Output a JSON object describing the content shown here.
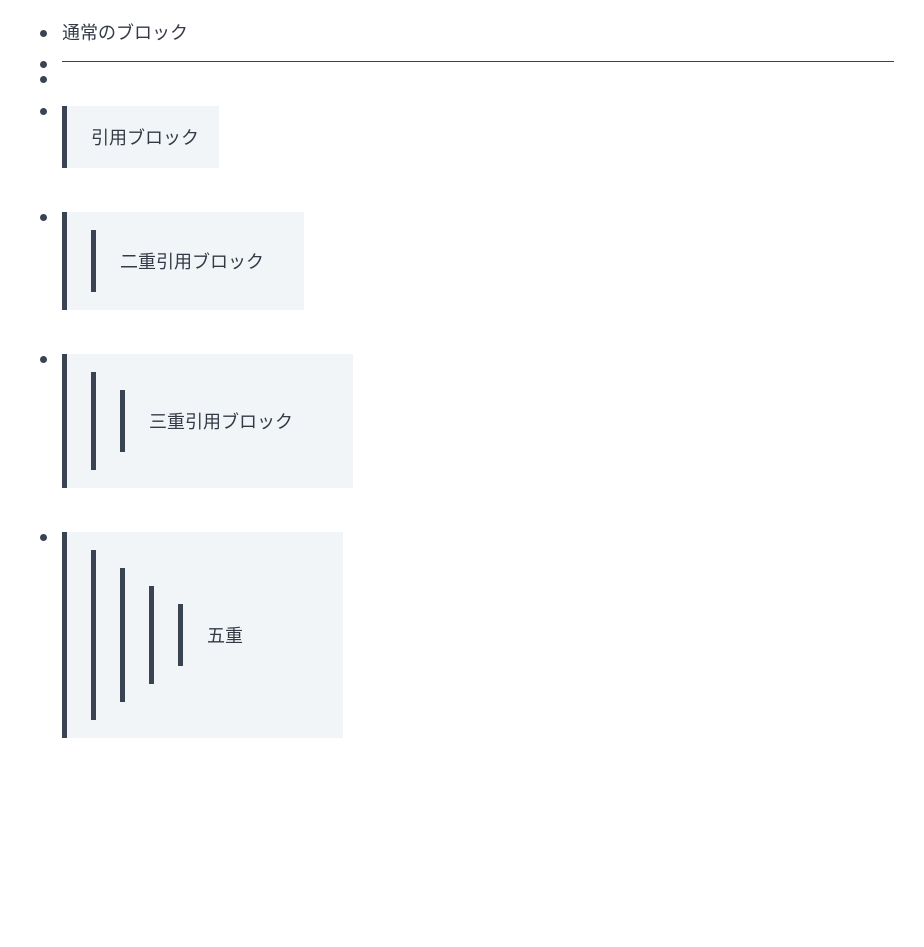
{
  "list": {
    "items": [
      {
        "type": "text",
        "text": "通常のブロック"
      },
      {
        "type": "hr"
      },
      {
        "type": "empty"
      },
      {
        "type": "blockquote",
        "depth": 1,
        "text": "引用ブロック"
      },
      {
        "type": "blockquote",
        "depth": 2,
        "text": "二重引用ブロック"
      },
      {
        "type": "blockquote",
        "depth": 3,
        "text": "三重引用ブロック"
      },
      {
        "type": "blockquote",
        "depth": 5,
        "text": "五重"
      }
    ]
  }
}
